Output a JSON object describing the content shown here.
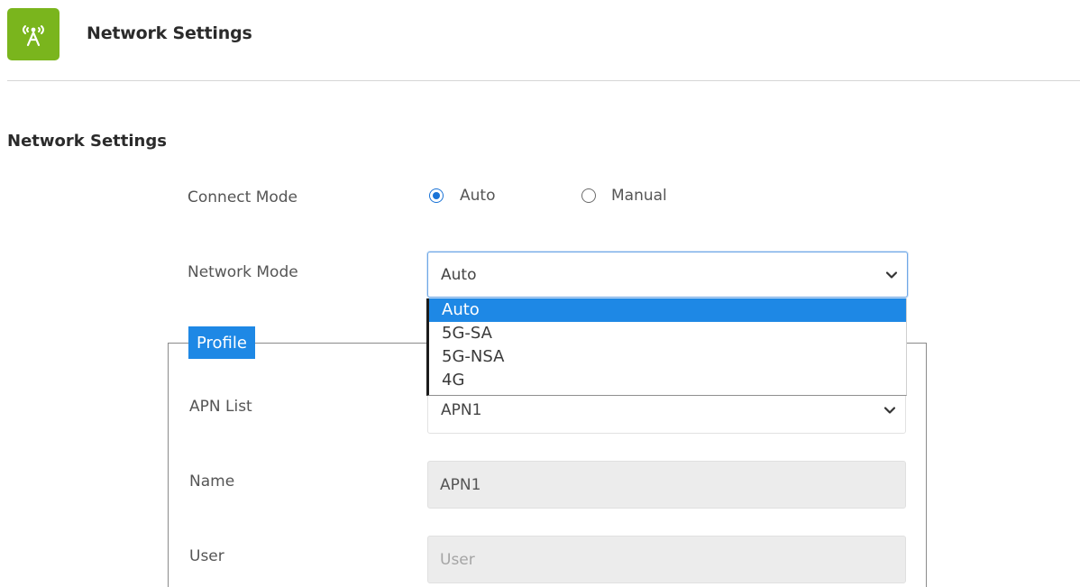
{
  "header": {
    "title": "Network Settings",
    "icon": "antenna-signal-icon",
    "icon_color": "#7ab51d"
  },
  "section": {
    "title": "Network Settings"
  },
  "connect_mode": {
    "label": "Connect Mode",
    "options": [
      {
        "label": "Auto",
        "checked": true
      },
      {
        "label": "Manual",
        "checked": false
      }
    ]
  },
  "network_mode": {
    "label": "Network Mode",
    "value": "Auto",
    "options": [
      "Auto",
      "5G-SA",
      "5G-NSA",
      "4G"
    ],
    "highlighted_option": "Auto"
  },
  "profile": {
    "legend": "Profile",
    "apn_list": {
      "label": "APN List",
      "value": "APN1"
    },
    "name": {
      "label": "Name",
      "value": "APN1"
    },
    "user": {
      "label": "User",
      "placeholder": "User"
    }
  },
  "colors": {
    "accent_blue": "#1e88e5",
    "radio_blue": "#1a73d6",
    "brand_green": "#7ab51d"
  }
}
